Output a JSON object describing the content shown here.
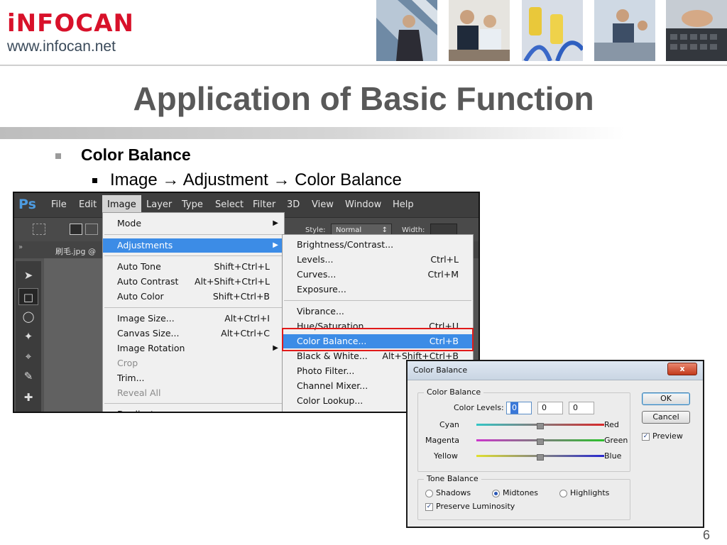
{
  "header": {
    "logo_text": "iNFOCAN",
    "logo_url": "www.infocan.net",
    "brand_color": "#d8112a"
  },
  "slide": {
    "title": "Application of Basic Function",
    "bullet_1": "Color Balance",
    "bullet_2": "Image → Adjustment → Color Balance",
    "page_number": "6"
  },
  "photoshop": {
    "logo": "Ps",
    "menubar": [
      "File",
      "Edit",
      "Image",
      "Layer",
      "Type",
      "Select",
      "Filter",
      "3D",
      "View",
      "Window",
      "Help"
    ],
    "options": {
      "style_label": "Style:",
      "style_value": "Normal",
      "width_label": "Width:"
    },
    "doc_tab": "刷毛.jpg @",
    "tools": [
      "move-tool-icon",
      "marquee-tool-icon",
      "lasso-tool-icon",
      "quick-select-tool-icon",
      "crop-tool-icon",
      "eyedropper-tool-icon",
      "healing-brush-tool-icon"
    ],
    "image_menu": [
      {
        "label": "Mode",
        "submenu": true
      },
      {
        "label": "Adjustments",
        "submenu": true,
        "highlighted": true
      },
      {
        "label": "Auto Tone",
        "shortcut": "Shift+Ctrl+L"
      },
      {
        "label": "Auto Contrast",
        "shortcut": "Alt+Shift+Ctrl+L"
      },
      {
        "label": "Auto Color",
        "shortcut": "Shift+Ctrl+B"
      },
      {
        "label": "Image Size...",
        "shortcut": "Alt+Ctrl+I"
      },
      {
        "label": "Canvas Size...",
        "shortcut": "Alt+Ctrl+C"
      },
      {
        "label": "Image Rotation",
        "submenu": true
      },
      {
        "label": "Crop",
        "disabled": true
      },
      {
        "label": "Trim..."
      },
      {
        "label": "Reveal All",
        "disabled": true
      },
      {
        "label": "Duplicate..."
      }
    ],
    "adjustments_menu": [
      {
        "label": "Brightness/Contrast..."
      },
      {
        "label": "Levels...",
        "shortcut": "Ctrl+L"
      },
      {
        "label": "Curves...",
        "shortcut": "Ctrl+M"
      },
      {
        "label": "Exposure..."
      },
      {
        "label": "Vibrance..."
      },
      {
        "label": "Hue/Saturation...",
        "shortcut": "Ctrl+U"
      },
      {
        "label": "Color Balance...",
        "shortcut": "Ctrl+B",
        "highlighted": true
      },
      {
        "label": "Black & White...",
        "shortcut": "Alt+Shift+Ctrl+B"
      },
      {
        "label": "Photo Filter..."
      },
      {
        "label": "Channel Mixer..."
      },
      {
        "label": "Color Lookup..."
      }
    ]
  },
  "dialog": {
    "title": "Color Balance",
    "close_label": "x",
    "color_balance_group": "Color Balance",
    "color_levels_label": "Color Levels:",
    "levels": [
      "0",
      "0",
      "0"
    ],
    "sliders": [
      {
        "left": "Cyan",
        "right": "Red",
        "value": 0,
        "gradient": [
          "#33c6c6",
          "#d8282a"
        ]
      },
      {
        "left": "Magenta",
        "right": "Green",
        "value": 0,
        "gradient": [
          "#cc36cc",
          "#2cc22c"
        ]
      },
      {
        "left": "Yellow",
        "right": "Blue",
        "value": 0,
        "gradient": [
          "#e0e030",
          "#2828d0"
        ]
      }
    ],
    "tone_balance_group": "Tone Balance",
    "tones": [
      {
        "label": "Shadows",
        "selected": false
      },
      {
        "label": "Midtones",
        "selected": true
      },
      {
        "label": "Highlights",
        "selected": false
      }
    ],
    "preserve_luminosity": {
      "label": "Preserve Luminosity",
      "checked": true
    },
    "ok_label": "OK",
    "cancel_label": "Cancel",
    "preview": {
      "label": "Preview",
      "checked": true
    }
  }
}
